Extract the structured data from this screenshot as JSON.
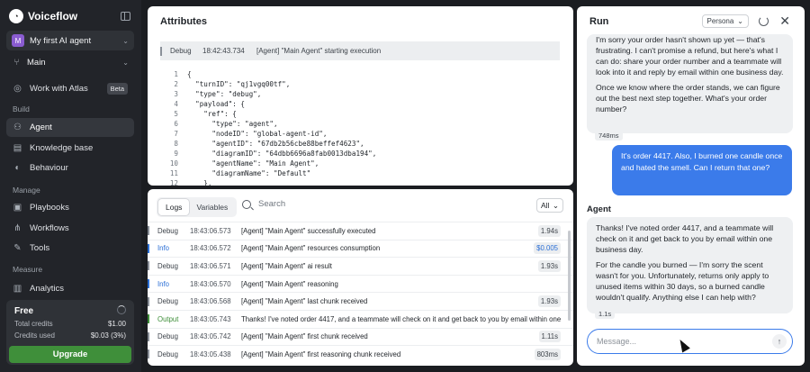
{
  "sidebar": {
    "brand": "Voiceflow",
    "project": {
      "initial": "M",
      "name": "My first AI agent"
    },
    "environment": "Main",
    "work_with_atlas": {
      "label": "Work with Atlas",
      "badge": "Beta"
    },
    "sections": {
      "build": "Build",
      "manage": "Manage",
      "measure": "Measure"
    },
    "build_items": [
      {
        "label": "Agent",
        "icon": "agent-icon"
      },
      {
        "label": "Knowledge base",
        "icon": "book-icon"
      },
      {
        "label": "Behaviour",
        "icon": "behaviour-icon"
      }
    ],
    "manage_items": [
      {
        "label": "Playbooks",
        "icon": "playbook-icon"
      },
      {
        "label": "Workflows",
        "icon": "workflow-icon"
      },
      {
        "label": "Tools",
        "icon": "wrench-icon"
      }
    ],
    "measure_items": [
      {
        "label": "Analytics",
        "icon": "chart-icon"
      }
    ],
    "plan": {
      "name": "Free",
      "total_credits_label": "Total credits",
      "total_credits_value": "$1.00",
      "credits_used_label": "Credits used",
      "credits_used_value": "$0.03 (3%)",
      "upgrade_label": "Upgrade"
    }
  },
  "attributes": {
    "title": "Attributes",
    "header": {
      "level": "Debug",
      "time": "18:42:43.734",
      "message": "[Agent] \"Main Agent\" starting execution"
    },
    "code_lines": [
      "{",
      "  \"turnID\": \"qj1vgq00tf\",",
      "  \"type\": \"debug\",",
      "  \"payload\": {",
      "    \"ref\": {",
      "      \"type\": \"agent\",",
      "      \"nodeID\": \"global-agent-id\",",
      "      \"agentID\": \"67db2b56cbe88beffef4623\",",
      "      \"diagramID\": \"64dbb6696a8fab0013dba194\",",
      "      \"agentName\": \"Main Agent\",",
      "      \"diagramName\": \"Default\"",
      "    },"
    ]
  },
  "logs": {
    "tabs": [
      "Logs",
      "Variables"
    ],
    "search_placeholder": "Search",
    "filter": "All",
    "rows": [
      {
        "level": "Debug",
        "time": "18:43:06.573",
        "message": "[Agent] \"Main Agent\" successfully executed",
        "badge": "1.94s"
      },
      {
        "level": "Info",
        "time": "18:43:06.572",
        "message": "[Agent] \"Main Agent\" resources consumption",
        "badge": "$0.005"
      },
      {
        "level": "Debug",
        "time": "18:43:06.571",
        "message": "[Agent] \"Main Agent\" ai result",
        "badge": "1.93s"
      },
      {
        "level": "Info",
        "time": "18:43:06.570",
        "message": "[Agent] \"Main Agent\" reasoning",
        "badge": ""
      },
      {
        "level": "Debug",
        "time": "18:43:06.568",
        "message": "[Agent] \"Main Agent\" last chunk received",
        "badge": "1.93s"
      },
      {
        "level": "Output",
        "time": "18:43:05.743",
        "message": "Thanks! I've noted order 4417, and a teammate will check on it and get back to you by email within one",
        "badge": ""
      },
      {
        "level": "Debug",
        "time": "18:43:05.742",
        "message": "[Agent] \"Main Agent\" first chunk received",
        "badge": "1.11s"
      },
      {
        "level": "Debug",
        "time": "18:43:05.438",
        "message": "[Agent] \"Main Agent\" first reasoning chunk received",
        "badge": "803ms"
      }
    ]
  },
  "run": {
    "title": "Run",
    "persona_label": "Persona",
    "agent_msg_1": [
      "I'm sorry your order hasn't shown up yet — that's frustrating. I can't promise a refund, but here's what I can do: share your order number and a teammate will look into it and reply by email within one business day.",
      "Once we know where the order stands, we can figure out the best next step together. What's your order number?"
    ],
    "latency_1": "748ms",
    "user_msg": "It's order 4417. Also, I burned one candle once and hated the smell. Can I return that one?",
    "agent_label": "Agent",
    "agent_msg_2": [
      "Thanks! I've noted order 4417, and a teammate will check on it and get back to you by email within one business day.",
      "For the candle you burned — I'm sorry the scent wasn't for you. Unfortunately, returns only apply to unused items within 30 days, so a burned candle wouldn't qualify. Anything else I can help with?"
    ],
    "latency_2": "1.1s",
    "input_placeholder": "Message..."
  },
  "colors": {
    "sidebar_bg": "#222429",
    "accent_blue": "#3b7bea",
    "upgrade_green": "#3f8f3a",
    "info_blue": "#2b6fd6"
  }
}
